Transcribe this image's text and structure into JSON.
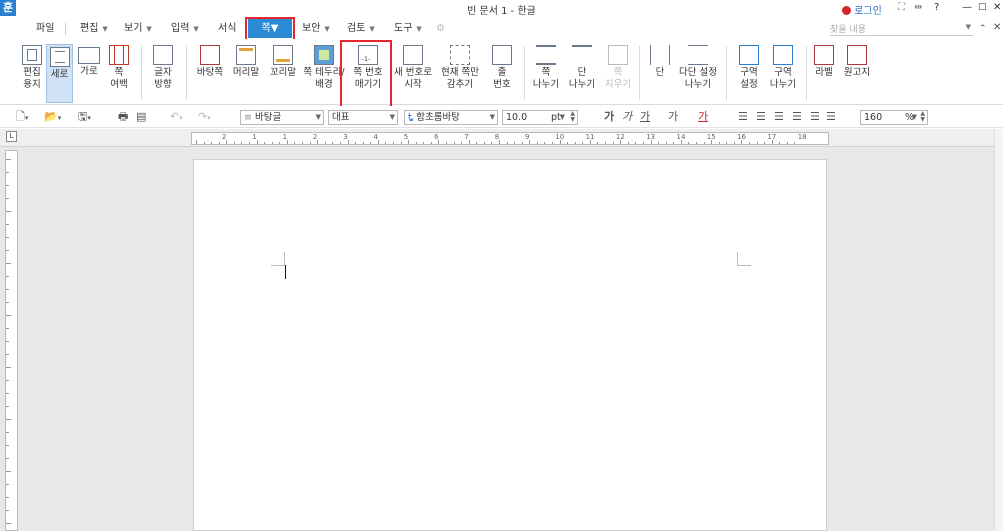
{
  "window": {
    "title": "빈 문서 1 - 한글",
    "app_logo": "훈",
    "login_label": "로그인",
    "help_label": "?",
    "search_placeholder": "찾을 내용"
  },
  "menus": [
    {
      "label": "파일",
      "has_caret": false
    },
    {
      "label": "편집",
      "has_caret": true
    },
    {
      "label": "보기",
      "has_caret": true
    },
    {
      "label": "입력",
      "has_caret": true
    },
    {
      "label": "서식",
      "has_caret": false
    },
    {
      "label": "쪽",
      "has_caret": true,
      "active": true
    },
    {
      "label": "보안",
      "has_caret": true
    },
    {
      "label": "검토",
      "has_caret": true
    },
    {
      "label": "도구",
      "has_caret": true
    }
  ],
  "ribbon": [
    {
      "label1": "편집",
      "label2": "용지",
      "icon": "page-setup-icon"
    },
    {
      "label1": "세로",
      "label2": "",
      "icon": "portrait-icon",
      "active": true
    },
    {
      "label1": "가로",
      "label2": "",
      "icon": "landscape-icon"
    },
    {
      "label1": "쪽",
      "label2": "여백",
      "icon": "margin-icon"
    },
    {
      "label1": "글자",
      "label2": "방향",
      "icon": "text-direction-icon"
    },
    {
      "label1": "바탕쪽",
      "label2": "",
      "icon": "master-page-icon"
    },
    {
      "label1": "머리말",
      "label2": "",
      "icon": "header-icon"
    },
    {
      "label1": "꼬리말",
      "label2": "",
      "icon": "footer-icon"
    },
    {
      "label1": "쪽 테두리/",
      "label2": "배경",
      "icon": "page-border-icon"
    },
    {
      "label1": "쪽 번호",
      "label2": "매기기",
      "icon": "page-number-icon",
      "highlighted": true
    },
    {
      "label1": "새 번호로",
      "label2": "시작",
      "icon": "new-number-icon"
    },
    {
      "label1": "현재 쪽만",
      "label2": "감추기",
      "icon": "hide-page-icon"
    },
    {
      "label1": "줄",
      "label2": "번호",
      "icon": "line-number-icon"
    },
    {
      "label1": "쪽",
      "label2": "나누기",
      "icon": "page-break-icon"
    },
    {
      "label1": "단",
      "label2": "나누기",
      "icon": "column-break-icon"
    },
    {
      "label1": "쪽",
      "label2": "지우기",
      "icon": "delete-page-icon",
      "disabled": true
    },
    {
      "label1": "단",
      "label2": "",
      "icon": "columns-icon"
    },
    {
      "label1": "다단 설정",
      "label2": "나누기",
      "icon": "multi-column-icon"
    },
    {
      "label1": "구역",
      "label2": "설정",
      "icon": "section-setup-icon"
    },
    {
      "label1": "구역",
      "label2": "나누기",
      "icon": "section-break-icon"
    },
    {
      "label1": "라벨",
      "label2": "",
      "icon": "label-icon"
    },
    {
      "label1": "원고지",
      "label2": "",
      "icon": "manuscript-icon"
    }
  ],
  "format": {
    "style": "바탕글",
    "lang": "대표",
    "font": "함초롬바탕",
    "size": "10.0",
    "size_unit": "pt",
    "zoom": "160",
    "zoom_unit": "%",
    "bold": "가",
    "italic": "가",
    "underline": "가",
    "strike": "가",
    "color": "가"
  },
  "ruler": {
    "numbers": [
      "2",
      "1",
      "1",
      "2",
      "3",
      "4",
      "5",
      "6",
      "7",
      "8",
      "9",
      "10",
      "11",
      "12",
      "13",
      "14",
      "15",
      "16",
      "17",
      "18"
    ]
  },
  "colors": {
    "accent": "#2b8ad4",
    "highlight": "#e6262c"
  }
}
